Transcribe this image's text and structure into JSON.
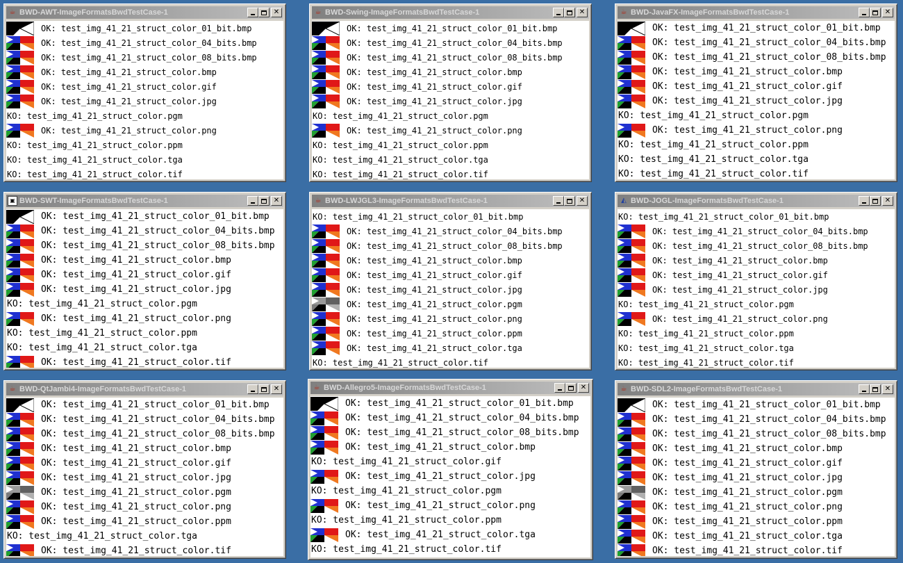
{
  "windows": [
    {
      "title": "BWD-AWT-ImageFormatsBwdTestCase-1",
      "icon": "java-cup-icon",
      "rows": [
        {
          "status": "OK",
          "text": "OK: test_img_41_21_struct_color_01_bit.bmp",
          "thumb": "bw"
        },
        {
          "status": "OK",
          "text": "OK: test_img_41_21_struct_color_04_bits.bmp",
          "thumb": "color"
        },
        {
          "status": "OK",
          "text": "OK: test_img_41_21_struct_color_08_bits.bmp",
          "thumb": "color"
        },
        {
          "status": "OK",
          "text": "OK: test_img_41_21_struct_color.bmp",
          "thumb": "color"
        },
        {
          "status": "OK",
          "text": "OK: test_img_41_21_struct_color.gif",
          "thumb": "color"
        },
        {
          "status": "OK",
          "text": "OK: test_img_41_21_struct_color.jpg",
          "thumb": "color"
        },
        {
          "status": "KO",
          "text": "KO: test_img_41_21_struct_color.pgm"
        },
        {
          "status": "OK",
          "text": "OK: test_img_41_21_struct_color.png",
          "thumb": "color"
        },
        {
          "status": "KO",
          "text": "KO: test_img_41_21_struct_color.ppm"
        },
        {
          "status": "KO",
          "text": "KO: test_img_41_21_struct_color.tga"
        },
        {
          "status": "KO",
          "text": "KO: test_img_41_21_struct_color.tif"
        }
      ]
    },
    {
      "title": "BWD-Swing-ImageFormatsBwdTestCase-1",
      "icon": "java-cup-icon",
      "rows": [
        {
          "status": "OK",
          "text": "OK: test_img_41_21_struct_color_01_bit.bmp",
          "thumb": "bw"
        },
        {
          "status": "OK",
          "text": "OK: test_img_41_21_struct_color_04_bits.bmp",
          "thumb": "color"
        },
        {
          "status": "OK",
          "text": "OK: test_img_41_21_struct_color_08_bits.bmp",
          "thumb": "color"
        },
        {
          "status": "OK",
          "text": "OK: test_img_41_21_struct_color.bmp",
          "thumb": "color"
        },
        {
          "status": "OK",
          "text": "OK: test_img_41_21_struct_color.gif",
          "thumb": "color"
        },
        {
          "status": "OK",
          "text": "OK: test_img_41_21_struct_color.jpg",
          "thumb": "color"
        },
        {
          "status": "KO",
          "text": "KO: test_img_41_21_struct_color.pgm"
        },
        {
          "status": "OK",
          "text": "OK: test_img_41_21_struct_color.png",
          "thumb": "color"
        },
        {
          "status": "KO",
          "text": "KO: test_img_41_21_struct_color.ppm"
        },
        {
          "status": "KO",
          "text": "KO: test_img_41_21_struct_color.tga"
        },
        {
          "status": "KO",
          "text": "KO: test_img_41_21_struct_color.tif"
        }
      ]
    },
    {
      "title": "BWD-JavaFX-ImageFormatsBwdTestCase-1",
      "icon": "java-cup-icon",
      "rows": [
        {
          "status": "OK",
          "text": "OK: test_img_41_21_struct_color_01_bit.bmp",
          "thumb": "bw"
        },
        {
          "status": "OK",
          "text": "OK: test_img_41_21_struct_color_04_bits.bmp",
          "thumb": "color"
        },
        {
          "status": "OK",
          "text": "OK: test_img_41_21_struct_color_08_bits.bmp",
          "thumb": "color"
        },
        {
          "status": "OK",
          "text": "OK: test_img_41_21_struct_color.bmp",
          "thumb": "color"
        },
        {
          "status": "OK",
          "text": "OK: test_img_41_21_struct_color.gif",
          "thumb": "color"
        },
        {
          "status": "OK",
          "text": "OK: test_img_41_21_struct_color.jpg",
          "thumb": "color"
        },
        {
          "status": "KO",
          "text": "KO: test_img_41_21_struct_color.pgm"
        },
        {
          "status": "OK",
          "text": "OK: test_img_41_21_struct_color.png",
          "thumb": "color"
        },
        {
          "status": "KO",
          "text": "KO: test_img_41_21_struct_color.ppm"
        },
        {
          "status": "KO",
          "text": "KO: test_img_41_21_struct_color.tga"
        },
        {
          "status": "KO",
          "text": "KO: test_img_41_21_struct_color.tif"
        }
      ]
    },
    {
      "title": "BWD-SWT-ImageFormatsBwdTestCase-1",
      "icon": "swt-icon",
      "rows": [
        {
          "status": "OK",
          "text": "OK: test_img_41_21_struct_color_01_bit.bmp",
          "thumb": "bw"
        },
        {
          "status": "OK",
          "text": "OK: test_img_41_21_struct_color_04_bits.bmp",
          "thumb": "color"
        },
        {
          "status": "OK",
          "text": "OK: test_img_41_21_struct_color_08_bits.bmp",
          "thumb": "color"
        },
        {
          "status": "OK",
          "text": "OK: test_img_41_21_struct_color.bmp",
          "thumb": "color"
        },
        {
          "status": "OK",
          "text": "OK: test_img_41_21_struct_color.gif",
          "thumb": "color"
        },
        {
          "status": "OK",
          "text": "OK: test_img_41_21_struct_color.jpg",
          "thumb": "color"
        },
        {
          "status": "KO",
          "text": "KO: test_img_41_21_struct_color.pgm"
        },
        {
          "status": "OK",
          "text": "OK: test_img_41_21_struct_color.png",
          "thumb": "color"
        },
        {
          "status": "KO",
          "text": "KO: test_img_41_21_struct_color.ppm"
        },
        {
          "status": "KO",
          "text": "KO: test_img_41_21_struct_color.tga"
        },
        {
          "status": "OK",
          "text": "OK: test_img_41_21_struct_color.tif",
          "thumb": "color"
        }
      ]
    },
    {
      "title": "BWD-LWJGL3-ImageFormatsBwdTestCase-1",
      "icon": "java-cup-icon",
      "rows": [
        {
          "status": "KO",
          "text": "KO: test_img_41_21_struct_color_01_bit.bmp"
        },
        {
          "status": "OK",
          "text": "OK: test_img_41_21_struct_color_04_bits.bmp",
          "thumb": "color"
        },
        {
          "status": "OK",
          "text": "OK: test_img_41_21_struct_color_08_bits.bmp",
          "thumb": "color"
        },
        {
          "status": "OK",
          "text": "OK: test_img_41_21_struct_color.bmp",
          "thumb": "color"
        },
        {
          "status": "OK",
          "text": "OK: test_img_41_21_struct_color.gif",
          "thumb": "color"
        },
        {
          "status": "OK",
          "text": "OK: test_img_41_21_struct_color.jpg",
          "thumb": "color"
        },
        {
          "status": "OK",
          "text": "OK: test_img_41_21_struct_color.pgm",
          "thumb": "gray"
        },
        {
          "status": "OK",
          "text": "OK: test_img_41_21_struct_color.png",
          "thumb": "color"
        },
        {
          "status": "OK",
          "text": "OK: test_img_41_21_struct_color.ppm",
          "thumb": "color"
        },
        {
          "status": "OK",
          "text": "OK: test_img_41_21_struct_color.tga",
          "thumb": "color"
        },
        {
          "status": "KO",
          "text": "KO: test_img_41_21_struct_color.tif"
        }
      ]
    },
    {
      "title": "BWD-JOGL-ImageFormatsBwdTestCase-1",
      "icon": "jogl-icon",
      "rows": [
        {
          "status": "KO",
          "text": "KO: test_img_41_21_struct_color_01_bit.bmp"
        },
        {
          "status": "OK",
          "text": "OK: test_img_41_21_struct_color_04_bits.bmp",
          "thumb": "color"
        },
        {
          "status": "OK",
          "text": "OK: test_img_41_21_struct_color_08_bits.bmp",
          "thumb": "color"
        },
        {
          "status": "OK",
          "text": "OK: test_img_41_21_struct_color.bmp",
          "thumb": "color"
        },
        {
          "status": "OK",
          "text": "OK: test_img_41_21_struct_color.gif",
          "thumb": "color"
        },
        {
          "status": "OK",
          "text": "OK: test_img_41_21_struct_color.jpg",
          "thumb": "color"
        },
        {
          "status": "KO",
          "text": "KO: test_img_41_21_struct_color.pgm"
        },
        {
          "status": "OK",
          "text": "OK: test_img_41_21_struct_color.png",
          "thumb": "color"
        },
        {
          "status": "KO",
          "text": "KO: test_img_41_21_struct_color.ppm"
        },
        {
          "status": "KO",
          "text": "KO: test_img_41_21_struct_color.tga"
        },
        {
          "status": "KO",
          "text": "KO: test_img_41_21_struct_color.tif"
        }
      ]
    },
    {
      "title": "BWD-QtJambi4-ImageFormatsBwdTestCase-1",
      "icon": "java-cup-icon",
      "rows": [
        {
          "status": "OK",
          "text": "OK: test_img_41_21_struct_color_01_bit.bmp",
          "thumb": "bw"
        },
        {
          "status": "OK",
          "text": "OK: test_img_41_21_struct_color_04_bits.bmp",
          "thumb": "color"
        },
        {
          "status": "OK",
          "text": "OK: test_img_41_21_struct_color_08_bits.bmp",
          "thumb": "color"
        },
        {
          "status": "OK",
          "text": "OK: test_img_41_21_struct_color.bmp",
          "thumb": "color"
        },
        {
          "status": "OK",
          "text": "OK: test_img_41_21_struct_color.gif",
          "thumb": "color"
        },
        {
          "status": "OK",
          "text": "OK: test_img_41_21_struct_color.jpg",
          "thumb": "color"
        },
        {
          "status": "OK",
          "text": "OK: test_img_41_21_struct_color.pgm",
          "thumb": "gray"
        },
        {
          "status": "OK",
          "text": "OK: test_img_41_21_struct_color.png",
          "thumb": "color"
        },
        {
          "status": "OK",
          "text": "OK: test_img_41_21_struct_color.ppm",
          "thumb": "color"
        },
        {
          "status": "KO",
          "text": "KO: test_img_41_21_struct_color.tga"
        },
        {
          "status": "OK",
          "text": "OK: test_img_41_21_struct_color.tif",
          "thumb": "color"
        }
      ]
    },
    {
      "title": "BWD-Allegro5-ImageFormatsBwdTestCase-1",
      "icon": "java-cup-icon",
      "rows": [
        {
          "status": "OK",
          "text": "OK: test_img_41_21_struct_color_01_bit.bmp",
          "thumb": "bw"
        },
        {
          "status": "OK",
          "text": "OK: test_img_41_21_struct_color_04_bits.bmp",
          "thumb": "color"
        },
        {
          "status": "OK",
          "text": "OK: test_img_41_21_struct_color_08_bits.bmp",
          "thumb": "color"
        },
        {
          "status": "OK",
          "text": "OK: test_img_41_21_struct_color.bmp",
          "thumb": "color"
        },
        {
          "status": "KO",
          "text": "KO: test_img_41_21_struct_color.gif"
        },
        {
          "status": "OK",
          "text": "OK: test_img_41_21_struct_color.jpg",
          "thumb": "color"
        },
        {
          "status": "KO",
          "text": "KO: test_img_41_21_struct_color.pgm"
        },
        {
          "status": "OK",
          "text": "OK: test_img_41_21_struct_color.png",
          "thumb": "color"
        },
        {
          "status": "KO",
          "text": "KO: test_img_41_21_struct_color.ppm"
        },
        {
          "status": "OK",
          "text": "OK: test_img_41_21_struct_color.tga",
          "thumb": "color"
        },
        {
          "status": "KO",
          "text": "KO: test_img_41_21_struct_color.tif"
        }
      ]
    },
    {
      "title": "BWD-SDL2-ImageFormatsBwdTestCase-1",
      "icon": "java-cup-icon",
      "rows": [
        {
          "status": "OK",
          "text": "OK: test_img_41_21_struct_color_01_bit.bmp",
          "thumb": "bw"
        },
        {
          "status": "OK",
          "text": "OK: test_img_41_21_struct_color_04_bits.bmp",
          "thumb": "color"
        },
        {
          "status": "OK",
          "text": "OK: test_img_41_21_struct_color_08_bits.bmp",
          "thumb": "color"
        },
        {
          "status": "OK",
          "text": "OK: test_img_41_21_struct_color.bmp",
          "thumb": "color"
        },
        {
          "status": "OK",
          "text": "OK: test_img_41_21_struct_color.gif",
          "thumb": "color"
        },
        {
          "status": "OK",
          "text": "OK: test_img_41_21_struct_color.jpg",
          "thumb": "color"
        },
        {
          "status": "OK",
          "text": "OK: test_img_41_21_struct_color.pgm",
          "thumb": "gray"
        },
        {
          "status": "OK",
          "text": "OK: test_img_41_21_struct_color.png",
          "thumb": "color"
        },
        {
          "status": "OK",
          "text": "OK: test_img_41_21_struct_color.ppm",
          "thumb": "color"
        },
        {
          "status": "OK",
          "text": "OK: test_img_41_21_struct_color.tga",
          "thumb": "color"
        },
        {
          "status": "OK",
          "text": "OK: test_img_41_21_struct_color.tif",
          "thumb": "color"
        }
      ]
    }
  ],
  "colors": {
    "desktop": "#3a6ea5",
    "titlebar_inactive_start": "#808080",
    "titlebar_inactive_end": "#c0c0c0"
  }
}
